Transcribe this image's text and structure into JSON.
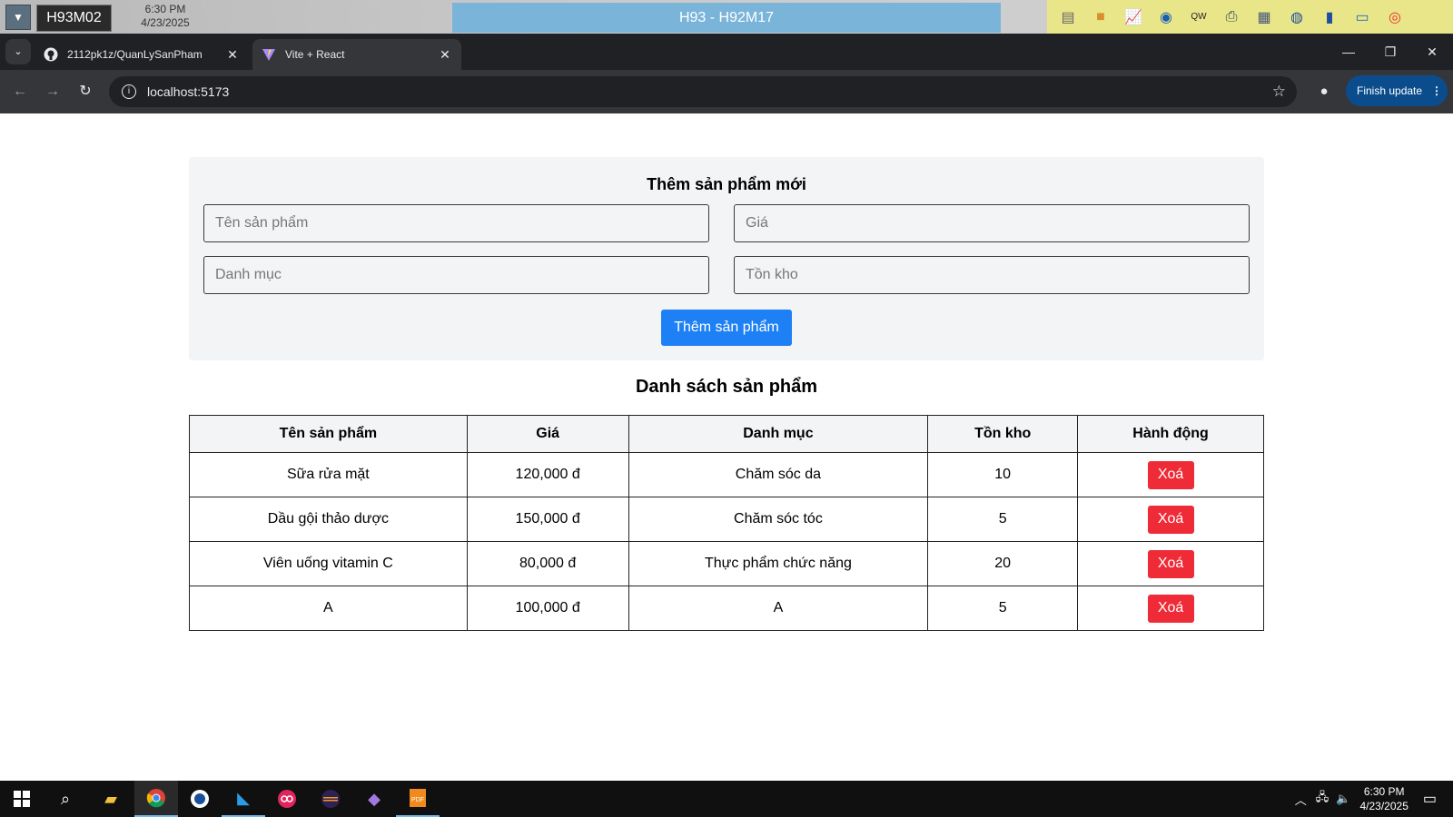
{
  "remote_bar": {
    "host": "H93M02",
    "time": "6:30 PM",
    "date": "4/23/2025",
    "session_title": "H93 - H92M17",
    "tools": [
      "cabinet-icon",
      "briefcase-icon",
      "chart-icon",
      "disc-icon",
      "keyboard-icon",
      "printer-icon",
      "window-icon",
      "globe-icon",
      "book-icon",
      "message-icon",
      "lifebuoy-icon"
    ]
  },
  "browser": {
    "tabs": [
      {
        "title": "2112pk1z/QuanLySanPham",
        "icon": "github-icon",
        "active": false
      },
      {
        "title": "Vite + React",
        "icon": "vite-icon",
        "active": true
      }
    ],
    "url": "localhost:5173",
    "finish_update_label": "Finish update"
  },
  "form": {
    "title": "Thêm sản phẩm mới",
    "name_placeholder": "Tên sản phẩm",
    "price_placeholder": "Giá",
    "category_placeholder": "Danh mục",
    "stock_placeholder": "Tồn kho",
    "submit_label": "Thêm sản phẩm"
  },
  "list": {
    "title": "Danh sách sản phẩm",
    "headers": [
      "Tên sản phẩm",
      "Giá",
      "Danh mục",
      "Tồn kho",
      "Hành động"
    ],
    "rows": [
      {
        "name": "Sữa rửa mặt",
        "price": "120,000 đ",
        "category": "Chăm sóc da",
        "stock": "10",
        "action": "Xoá"
      },
      {
        "name": "Dầu gội thảo dược",
        "price": "150,000 đ",
        "category": "Chăm sóc tóc",
        "stock": "5",
        "action": "Xoá"
      },
      {
        "name": "Viên uống vitamin C",
        "price": "80,000 đ",
        "category": "Thực phẩm chức năng",
        "stock": "20",
        "action": "Xoá"
      },
      {
        "name": "A",
        "price": "100,000 đ",
        "category": "A",
        "stock": "5",
        "action": "Xoá"
      }
    ]
  },
  "taskbar": {
    "apps": [
      "start-icon",
      "search-icon",
      "file-explorer-icon",
      "chrome-icon",
      "app-icon",
      "vscode-icon",
      "app-icon-pink",
      "eclipse-icon",
      "visual-studio-icon",
      "pdf-icon"
    ],
    "time": "6:30 PM",
    "date": "4/23/2025"
  }
}
